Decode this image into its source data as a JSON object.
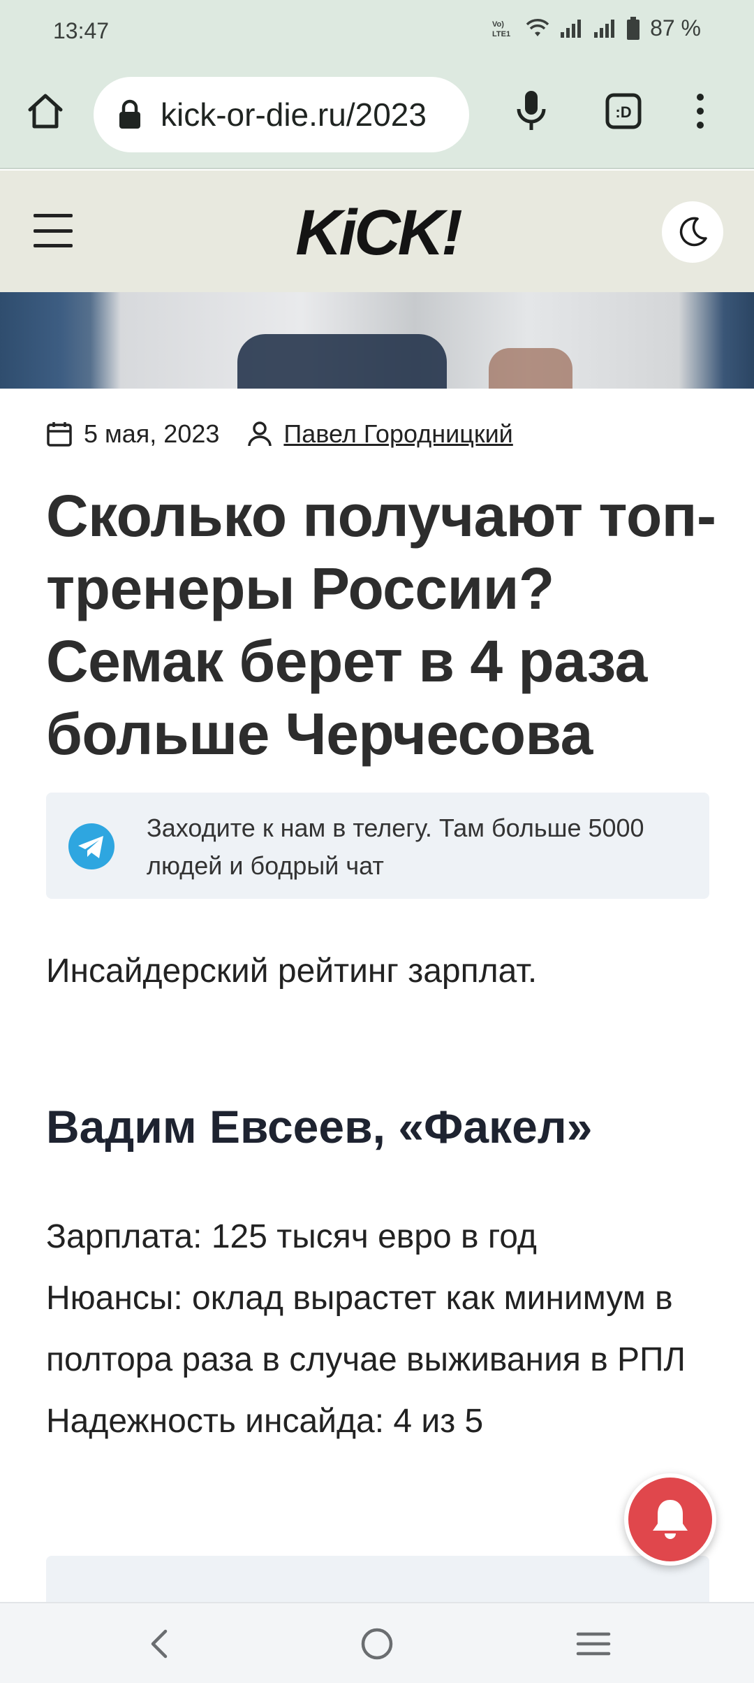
{
  "status_bar": {
    "time": "13:47",
    "battery": "87 %",
    "icons": [
      "volte-icon",
      "wifi-icon",
      "signal-icon",
      "signal-icon",
      "battery-icon"
    ]
  },
  "browser": {
    "url": "kick-or-die.ru/2023",
    "icons": [
      "home-icon",
      "lock-icon",
      "mic-icon",
      "tabs-icon",
      "more-vert-icon"
    ]
  },
  "site": {
    "logo_text": "KiCK!",
    "icons": [
      "hamburger-icon",
      "moon-icon"
    ]
  },
  "article": {
    "date": "5 мая, 2023",
    "author": "Павел Городницкий",
    "title": "Сколько получают топ-тренеры России? Семак берет в 4 раза больше Черчесова",
    "telegram_promo": "Заходите к нам в телегу. Там больше 5000 людей и бодрый чат",
    "lead": "Инсайдерский рейтинг зарплат.",
    "section_heading": "Вадим Евсеев, «Факел»",
    "info_lines": [
      "Зарплата: 125 тысяч евро в год",
      "Нюансы: оклад вырастет как минимум в полтора раза в случае выживания в РПЛ",
      "Надежность инсайда: 4 из 5"
    ]
  },
  "colors": {
    "accent_red": "#e0474c",
    "telegram_blue": "#2ea6e0",
    "header_bg": "#e8e9df",
    "browser_bg": "#dde9e0"
  }
}
